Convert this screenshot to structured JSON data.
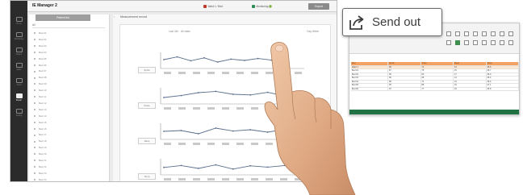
{
  "app": {
    "title": "IE Manager 2",
    "status_left": "Ward 1 / Bed",
    "status_right": "Monitoring 🟢",
    "export_label": "Export"
  },
  "rail": {
    "items": [
      {
        "label": "Home"
      },
      {
        "label": "Monitoring"
      },
      {
        "label": "Patient"
      },
      {
        "label": "Alarm"
      },
      {
        "label": "Trend"
      },
      {
        "label": "Report"
      },
      {
        "label": "Setting"
      }
    ]
  },
  "list": {
    "header": "Patient list",
    "filter": "All",
    "rows": [
      "Bed 01",
      "Bed 02",
      "Bed 03",
      "Bed 04",
      "Bed 05",
      "Bed 06",
      "Bed 07",
      "Bed 08",
      "Bed 09",
      "Bed 10",
      "Bed 11",
      "Bed 12",
      "Bed 13",
      "Bed 14",
      "Bed 15",
      "Bed 16",
      "Bed 17",
      "Bed 18",
      "Bed 19",
      "Bed 20",
      "Bed 21",
      "Bed 22",
      "Bed 23",
      "Bed 24"
    ]
  },
  "panel": {
    "tab": "Measurement record",
    "legend": "Last 24h  ·  All vitals",
    "range": "Day  Week",
    "row_labels": [
      "SpO2",
      "Pulse",
      "Resp",
      "Temp"
    ]
  },
  "chart_data": {
    "type": "line",
    "series": [
      {
        "values": [
          55,
          72,
          48,
          66,
          40,
          58,
          50,
          62,
          52,
          60
        ]
      },
      {
        "values": [
          40,
          52,
          70,
          78,
          60,
          56,
          72,
          50
        ]
      },
      {
        "values": [
          50,
          55,
          35,
          70,
          52,
          60,
          45,
          62
        ]
      },
      {
        "values": [
          46,
          58,
          40,
          62,
          36,
          56,
          48,
          58
        ]
      }
    ]
  },
  "callout": {
    "label": "Send out",
    "icon": "share-arrow-icon"
  },
  "sheet": {
    "header_row": [
      "Bed",
      "SpO2",
      "Pulse",
      "Resp",
      "Temp"
    ],
    "subhead_row": [
      "Ward 1",
      "98",
      "72",
      "16",
      "36.5"
    ],
    "rows": [
      [
        "Bed 01",
        "97",
        "75",
        "15",
        "36.7"
      ],
      [
        "Bed 02",
        "96",
        "80",
        "17",
        "36.9"
      ],
      [
        "Bed 03",
        "99",
        "68",
        "14",
        "36.4"
      ],
      [
        "Bed 04",
        "98",
        "71",
        "16",
        "36.6"
      ],
      [
        "Bed 05",
        "95",
        "88",
        "19",
        "37.1"
      ],
      [
        "Bed 06",
        "97",
        "77",
        "16",
        "36.8"
      ]
    ],
    "accent": "#217346",
    "header_color": "#f4a261"
  }
}
